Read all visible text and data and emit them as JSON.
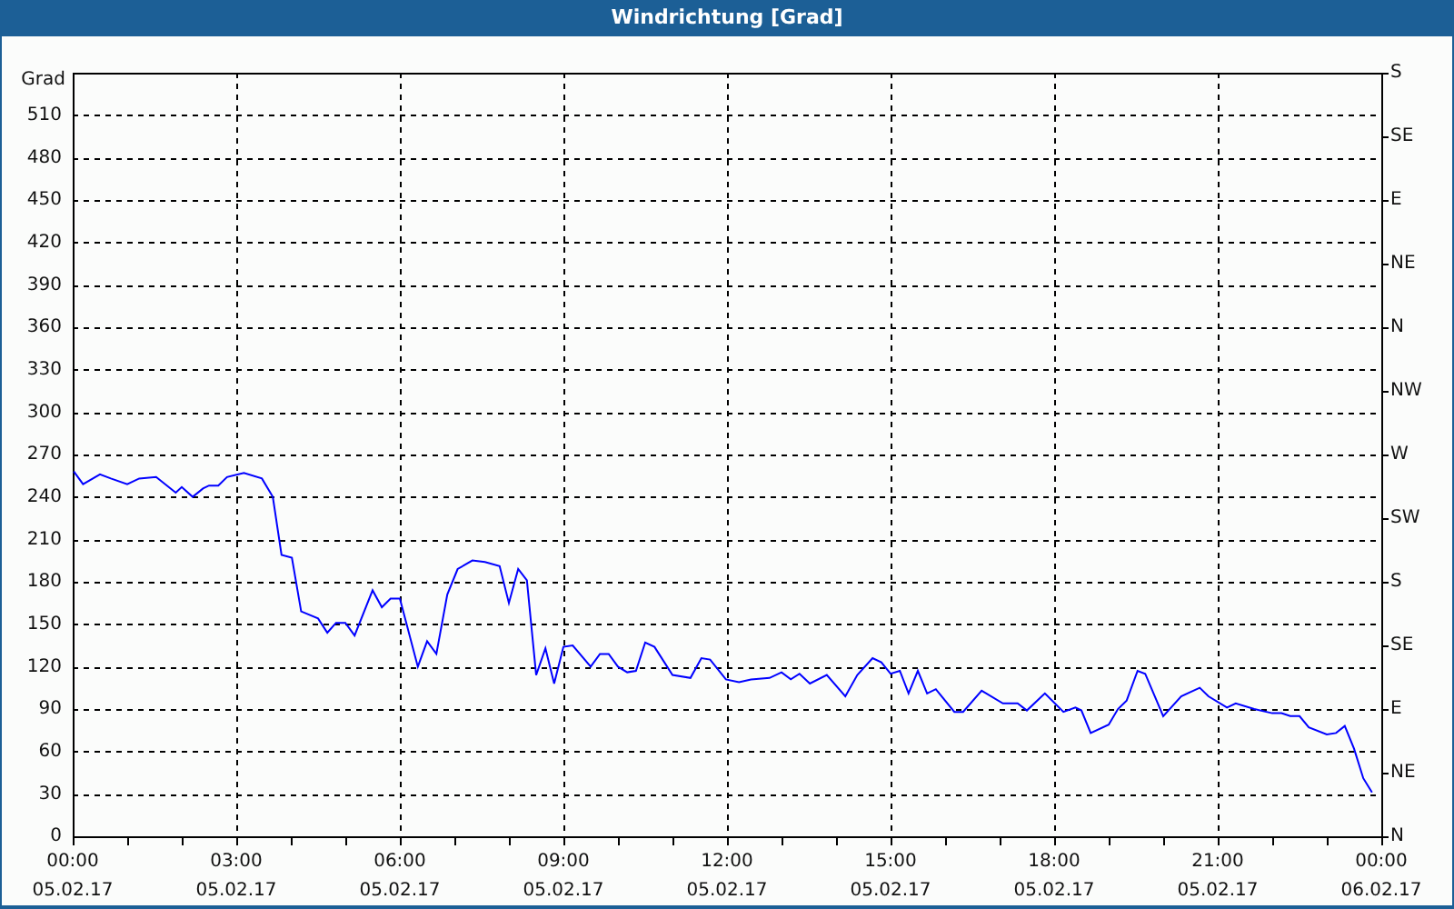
{
  "window": {
    "title": "Windrichtung [Grad]"
  },
  "chart": {
    "y_unit": "Grad",
    "x_dates": [
      "05.02.17",
      "05.02.17",
      "05.02.17",
      "05.02.17",
      "05.02.17",
      "05.02.17",
      "05.02.17",
      "05.02.17",
      "06.02.17"
    ],
    "right_axis_labels": [
      "S",
      "SE",
      "E",
      "NE",
      "N",
      "NW",
      "W",
      "SW",
      "S",
      "SE",
      "E",
      "NE",
      "N"
    ],
    "chart_data": {
      "type": "line",
      "grid": true,
      "xlim": [
        0,
        24
      ],
      "ylim": [
        0,
        540
      ],
      "xticks": [
        {
          "value": 0,
          "label": "00:00"
        },
        {
          "value": 3,
          "label": "03:00"
        },
        {
          "value": 6,
          "label": "06:00"
        },
        {
          "value": 9,
          "label": "09:00"
        },
        {
          "value": 12,
          "label": "12:00"
        },
        {
          "value": 15,
          "label": "15:00"
        },
        {
          "value": 18,
          "label": "18:00"
        },
        {
          "value": 21,
          "label": "21:00"
        },
        {
          "value": 24,
          "label": "00:00"
        }
      ],
      "yticks": [
        0,
        30,
        60,
        90,
        120,
        150,
        180,
        210,
        240,
        270,
        300,
        330,
        360,
        390,
        420,
        450,
        480,
        510
      ],
      "x": [
        0.02,
        0.19,
        0.5,
        0.7,
        1.0,
        1.22,
        1.53,
        1.89,
        2.0,
        2.2,
        2.39,
        2.5,
        2.67,
        2.83,
        3.14,
        3.47,
        3.67,
        3.83,
        4.02,
        4.19,
        4.5,
        4.67,
        4.83,
        5.0,
        5.17,
        5.5,
        5.67,
        5.83,
        6.0,
        6.33,
        6.5,
        6.67,
        6.87,
        7.06,
        7.33,
        7.56,
        7.83,
        8.0,
        8.17,
        8.33,
        8.5,
        8.67,
        8.83,
        9.0,
        9.17,
        9.5,
        9.67,
        9.83,
        10.0,
        10.17,
        10.33,
        10.5,
        10.67,
        11.0,
        11.33,
        11.53,
        11.69,
        11.98,
        12.22,
        12.44,
        12.78,
        13.0,
        13.17,
        13.33,
        13.52,
        13.83,
        14.17,
        14.39,
        14.67,
        14.83,
        15.0,
        15.17,
        15.33,
        15.5,
        15.67,
        15.83,
        16.17,
        16.33,
        16.67,
        17.06,
        17.33,
        17.5,
        17.83,
        18.17,
        18.39,
        18.5,
        18.67,
        19.0,
        19.17,
        19.33,
        19.53,
        19.67,
        20.0,
        20.33,
        20.67,
        20.83,
        21.17,
        21.33,
        21.67,
        22.0,
        22.17,
        22.33,
        22.5,
        22.67,
        23.0,
        23.17,
        23.33,
        23.5,
        23.67,
        23.83
      ],
      "series": [
        {
          "color": "#0000ff",
          "values": [
            258,
            249,
            256,
            253,
            249,
            253,
            254,
            243,
            247,
            240,
            246,
            248,
            248,
            254,
            257,
            253,
            240,
            199,
            197,
            159,
            154,
            144,
            151,
            151,
            142,
            174,
            162,
            168,
            168,
            120,
            138,
            129,
            171,
            189,
            195,
            194,
            191,
            165,
            189,
            181,
            114,
            133,
            108,
            134,
            135,
            120,
            129,
            129,
            120,
            116,
            117,
            137,
            134,
            114,
            112,
            126,
            125,
            111,
            109,
            111,
            112,
            116,
            111,
            115,
            108,
            114,
            99,
            114,
            126,
            123,
            115,
            117,
            101,
            117,
            101,
            104,
            88,
            88,
            103,
            94,
            94,
            89,
            101,
            88,
            91,
            89,
            73,
            79,
            90,
            96,
            117,
            115,
            85,
            99,
            105,
            99,
            91,
            94,
            90,
            87,
            87,
            85,
            85,
            77,
            72,
            73,
            78,
            62,
            41,
            31
          ]
        }
      ]
    }
  }
}
